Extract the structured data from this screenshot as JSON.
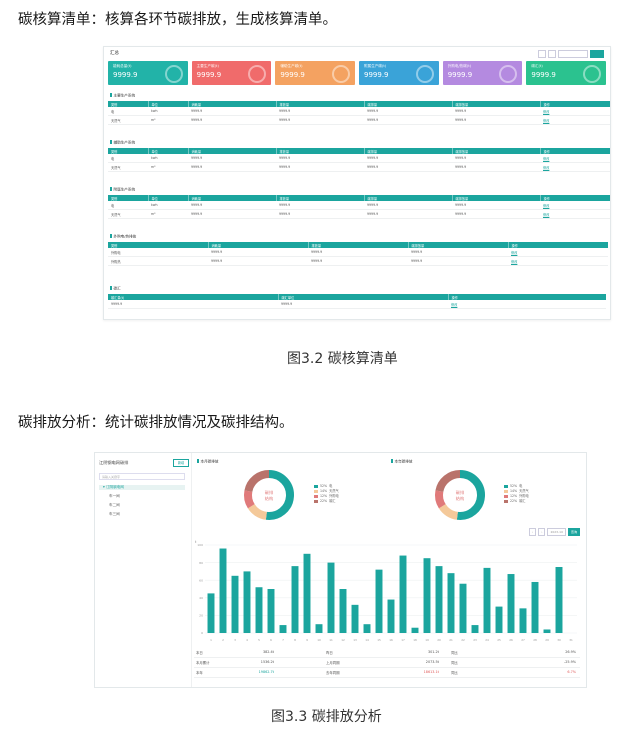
{
  "text": {
    "para1": "碳核算清单：核算各环节碳排放，生成核算清单。",
    "caption1": "图3.2  碳核算清单",
    "para2": "碳排放分析：统计碳排放情况及碳排结构。",
    "caption2": "图3.3  碳排放分析"
  },
  "colors": {
    "teal": "#1ba59e",
    "card1": "#22b3a8",
    "card2": "#f06b6b",
    "card3": "#f4a261",
    "card4": "#3aa3d8",
    "card5": "#b48ae0",
    "card6": "#2bc28f",
    "donut": [
      "#1ba59e",
      "#f4c99a",
      "#e07a7a",
      "#b9736b"
    ]
  },
  "fig1": {
    "title": "汇总",
    "cards": [
      {
        "label": "能耗总量(t)",
        "value": "9999.9"
      },
      {
        "label": "主要生产碳(t)",
        "value": "9999.9"
      },
      {
        "label": "辅助生产碳(t)",
        "value": "9999.9"
      },
      {
        "label": "附属生产碳(t)",
        "value": "9999.9"
      },
      {
        "label": "外购电/热碳(t)",
        "value": "9999.9"
      },
      {
        "label": "碳汇(t)",
        "value": "9999.9"
      }
    ],
    "sections": [
      {
        "title": "主要生产系统",
        "headers": [
          "类别",
          "单位",
          "消耗量",
          "排放量",
          "碳排量",
          "碳排放量",
          "操作"
        ],
        "rows": [
          [
            "电",
            "kwh",
            "9999.9",
            "9999.9",
            "9999.9",
            "9999.9",
            "修改"
          ],
          [
            "天然气",
            "m³",
            "9999.9",
            "9999.9",
            "9999.9",
            "9999.9",
            "修改"
          ]
        ]
      },
      {
        "title": "辅助生产系统",
        "headers": [
          "类别",
          "单位",
          "消耗量",
          "排放量",
          "碳排量",
          "碳排放量",
          "操作"
        ],
        "rows": [
          [
            "电",
            "kwh",
            "9999.9",
            "9999.9",
            "9999.9",
            "9999.9",
            "修改"
          ],
          [
            "天然气",
            "m³",
            "9999.9",
            "9999.9",
            "9999.9",
            "9999.9",
            "修改"
          ]
        ]
      },
      {
        "title": "附属生产系统",
        "headers": [
          "类别",
          "单位",
          "消耗量",
          "排放量",
          "碳排量",
          "碳排放量",
          "操作"
        ],
        "rows": [
          [
            "电",
            "kwh",
            "9999.9",
            "9999.9",
            "9999.9",
            "9999.9",
            "修改"
          ],
          [
            "天然气",
            "m³",
            "9999.9",
            "9999.9",
            "9999.9",
            "9999.9",
            "修改"
          ]
        ]
      },
      {
        "title": "外购电/热排放",
        "headers": [
          "类别",
          "消耗量",
          "排放量",
          "碳排放量",
          "操作"
        ],
        "rows": [
          [
            "外购电",
            "9999.9",
            "9999.9",
            "9999.9",
            "修改"
          ],
          [
            "外购热",
            "9999.9",
            "9999.9",
            "9999.9",
            "修改"
          ]
        ]
      },
      {
        "title": "碳汇",
        "headers": [
          "碳汇量(t)",
          "碳汇单位",
          "操作"
        ],
        "rows": [
          [
            "9999.9",
            "9999.9",
            "修改"
          ]
        ]
      }
    ]
  },
  "fig2": {
    "left_title": "江阴钢电网碳排",
    "left_button": "新增",
    "search_placeholder": "请输入关键字",
    "tree": [
      "江阴钢电网",
      "车一间",
      "车二间",
      "车三间"
    ],
    "panel1_title": "本月碳排放",
    "panel2_title": "本年碳排放",
    "donut_center": "碳排结构",
    "legend": [
      {
        "pct": "52%",
        "name": "电"
      },
      {
        "pct": "14%",
        "name": "天然气"
      },
      {
        "pct": "12%",
        "name": "外购电"
      },
      {
        "pct": "22%",
        "name": "碳汇"
      }
    ],
    "toolbar_date": "2023-10",
    "toolbar_button": "查询",
    "y_unit": "t",
    "summary": [
      [
        {
          "l": "本日",
          "v": "382.4t"
        },
        {
          "l": "昨日",
          "v": "301.2t"
        },
        {
          "l": "同比",
          "v": "26.9%"
        }
      ],
      [
        {
          "l": "本月累计",
          "v": "1536.2t"
        },
        {
          "l": "上月同期",
          "v": "2073.5t"
        },
        {
          "l": "同比",
          "v": "-25.9%"
        }
      ],
      [
        {
          "l": "本年",
          "v": "19862.7t"
        },
        {
          "l": "去年同期",
          "v": "18613.1t"
        },
        {
          "l": "同比",
          "v": "6.7%"
        }
      ]
    ],
    "chart_data": {
      "type": "bar",
      "title": "",
      "xlabel": "",
      "ylabel": "t",
      "ylim": [
        0,
        100
      ],
      "categories": [
        "1",
        "2",
        "3",
        "4",
        "5",
        "6",
        "7",
        "8",
        "9",
        "10",
        "11",
        "12",
        "13",
        "14",
        "15",
        "16",
        "17",
        "18",
        "19",
        "20",
        "21",
        "22",
        "23",
        "24",
        "25",
        "26",
        "27",
        "28",
        "29",
        "30",
        "31"
      ],
      "values": [
        45,
        96,
        65,
        70,
        52,
        50,
        9,
        76,
        90,
        10,
        80,
        50,
        32,
        10,
        72,
        38,
        88,
        6,
        85,
        76,
        68,
        56,
        9,
        74,
        30,
        67,
        28,
        58,
        4,
        75,
        0
      ],
      "grid": true
    }
  }
}
